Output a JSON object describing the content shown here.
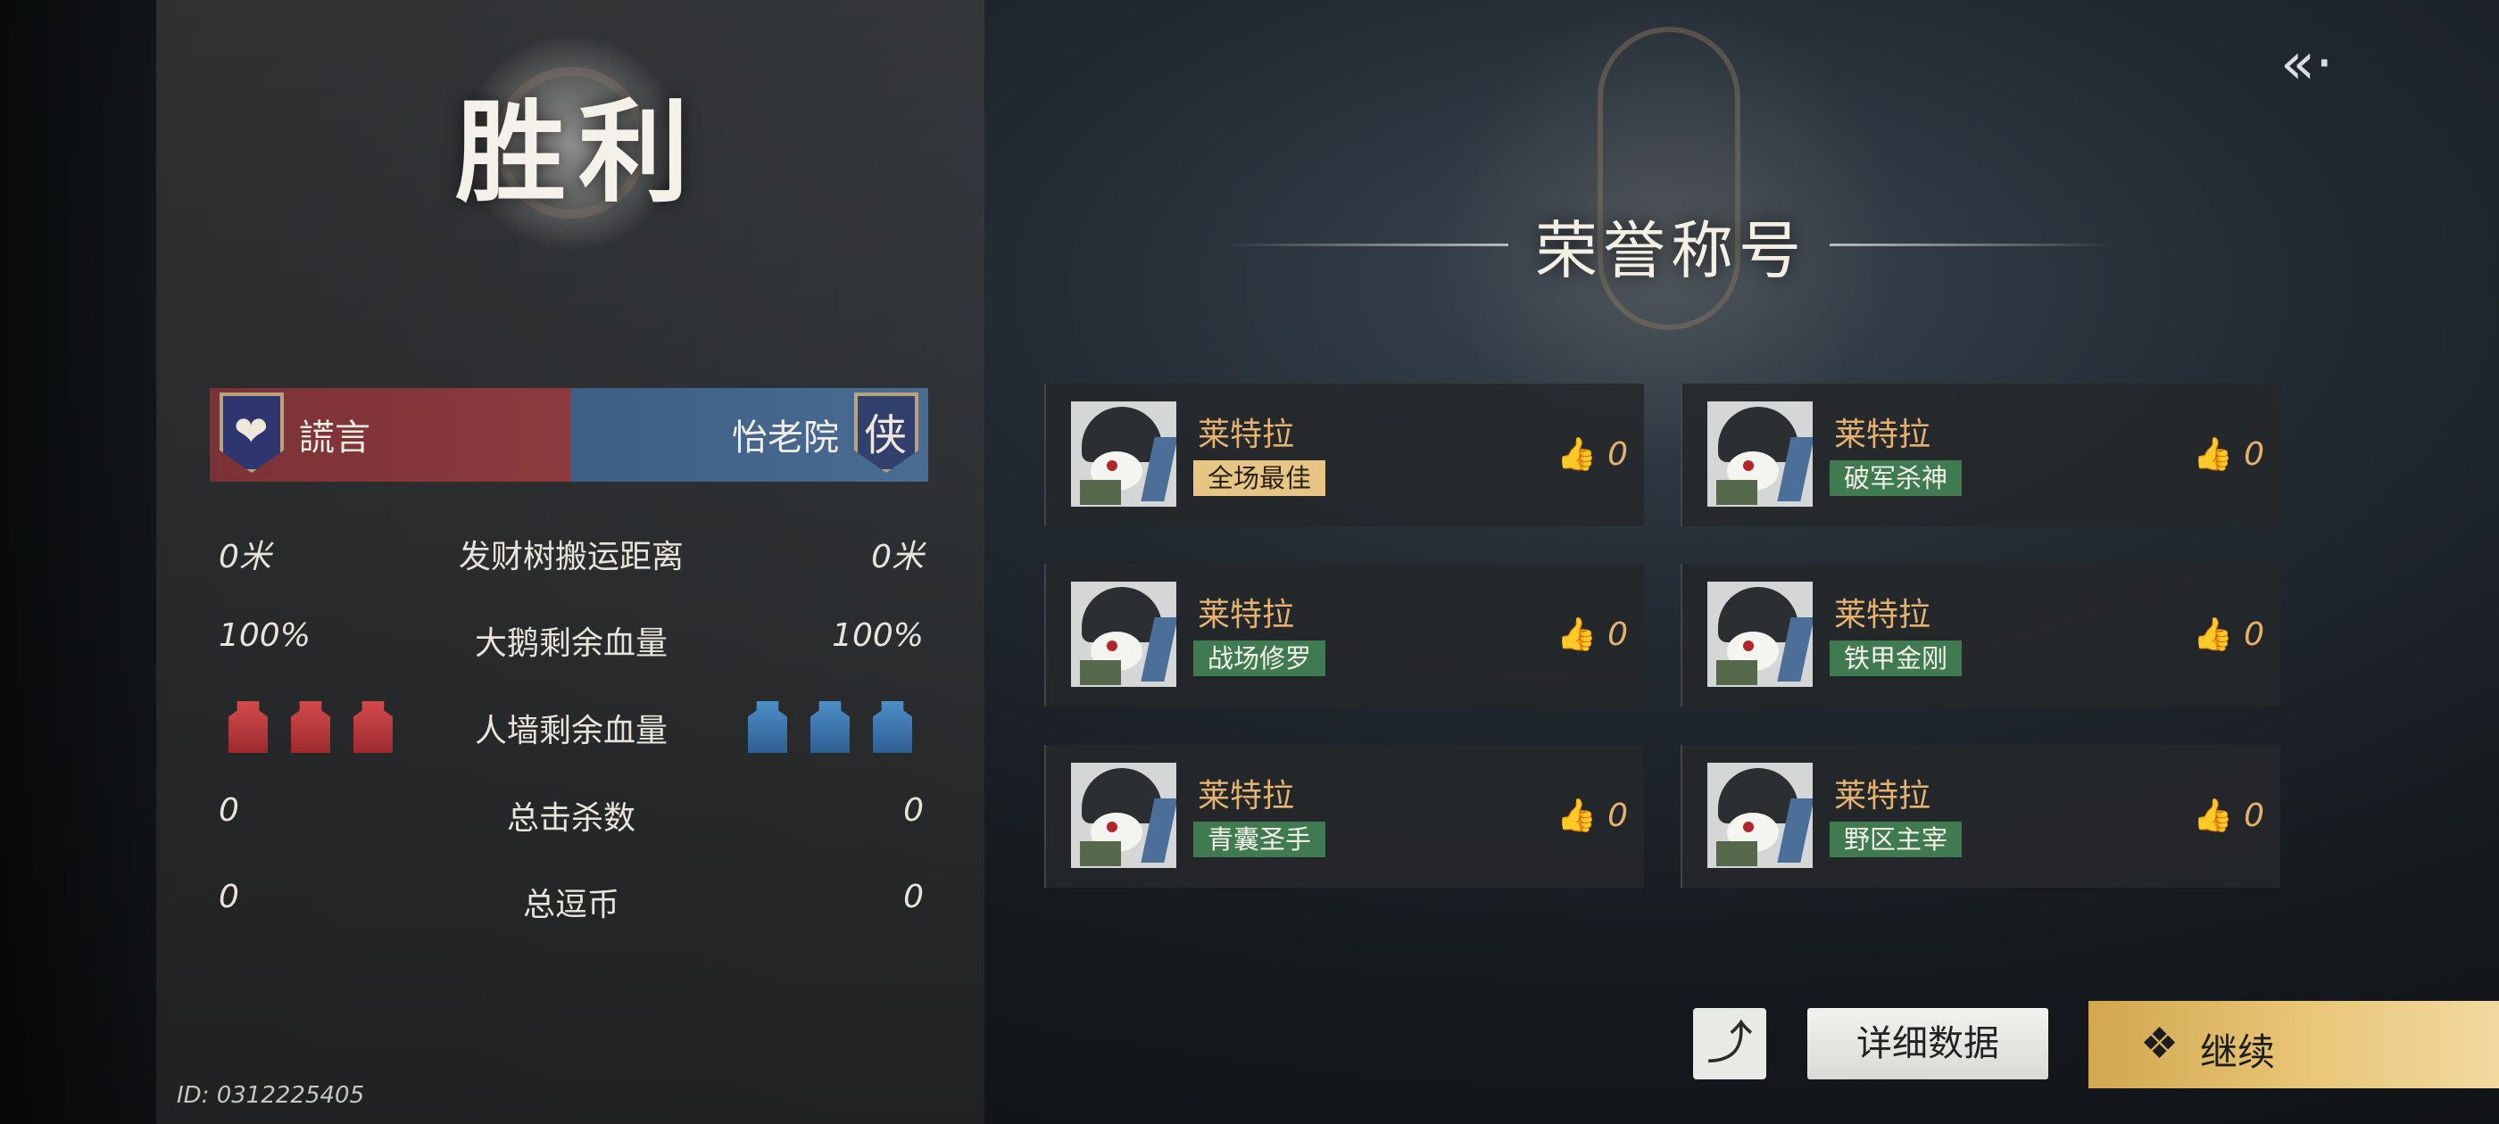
{
  "result": {
    "title": "胜利"
  },
  "teams": {
    "left": {
      "name": "謊言",
      "emblem_icon": "heart-shield-icon",
      "color": "#8c3a3e"
    },
    "right": {
      "name": "怡老院",
      "emblem_char": "侠",
      "color": "#4a6c92"
    }
  },
  "stats": [
    {
      "label": "发财树搬运距离",
      "left": "0米",
      "right": "0米"
    },
    {
      "label": "大鹅剩余血量",
      "left": "100%",
      "right": "100%"
    },
    {
      "label": "人墙剩余血量",
      "left_walls": 3,
      "right_walls": 3
    },
    {
      "label": "总击杀数",
      "left": "0",
      "right": "0"
    },
    {
      "label": "总逗币",
      "left": "0",
      "right": "0"
    }
  ],
  "game_id": "ID: 0312225405",
  "honor": {
    "title": "荣誉称号",
    "cards": [
      {
        "player": "莱特拉",
        "title": "全场最佳",
        "likes": "0",
        "highlight": true
      },
      {
        "player": "莱特拉",
        "title": "破军杀神",
        "likes": "0",
        "highlight": false
      },
      {
        "player": "莱特拉",
        "title": "战场修罗",
        "likes": "0",
        "highlight": false
      },
      {
        "player": "莱特拉",
        "title": "铁甲金刚",
        "likes": "0",
        "highlight": false
      },
      {
        "player": "莱特拉",
        "title": "青囊圣手",
        "likes": "0",
        "highlight": false
      },
      {
        "player": "莱特拉",
        "title": "野区主宰",
        "likes": "0",
        "highlight": false
      }
    ]
  },
  "buttons": {
    "details": "详细数据",
    "continue": "继续",
    "share_icon": "share-icon",
    "back_icon": "back-arrow-icon"
  },
  "colors": {
    "gold_accent": "#e6b26f",
    "badge_green": "#3f7a50",
    "badge_gold": "#e6c585"
  }
}
